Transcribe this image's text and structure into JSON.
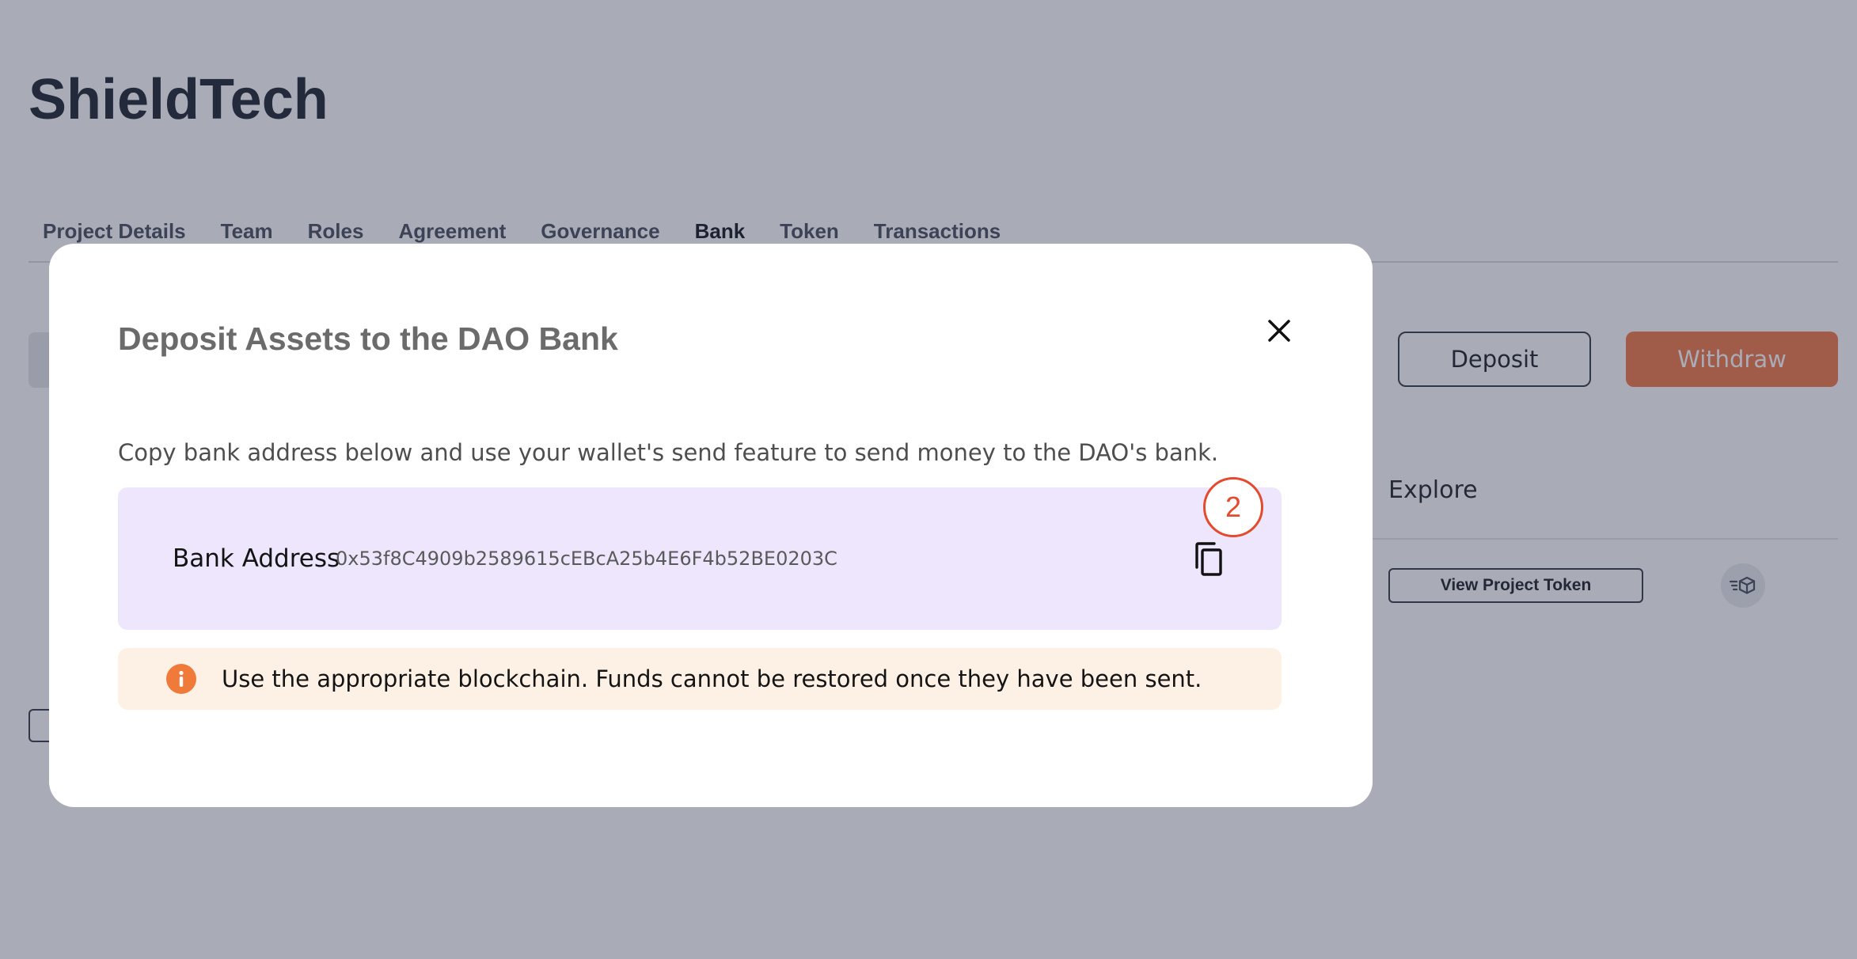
{
  "project": {
    "title": "ShieldTech"
  },
  "tabs": [
    {
      "label": "Project Details"
    },
    {
      "label": "Team"
    },
    {
      "label": "Roles"
    },
    {
      "label": "Agreement"
    },
    {
      "label": "Governance"
    },
    {
      "label": "Bank",
      "active": true
    },
    {
      "label": "Token"
    },
    {
      "label": "Transactions"
    }
  ],
  "bank_actions": {
    "deposit_label": "Deposit",
    "withdraw_label": "Withdraw"
  },
  "token_section": {
    "explore_label": "Explore",
    "view_token_label": "View Project Token"
  },
  "modal": {
    "title": "Deposit Assets to the DAO Bank",
    "description": "Copy bank address below and use your wallet's send feature to send money to the DAO's bank.",
    "address_label": "Bank Address",
    "address_value": "0x53f8C4909b2589615cEBcA25b4E6F4b52BE0203C",
    "step_badge": "2",
    "warning": "Use the appropriate blockchain. Funds cannot be restored once they have been sent."
  },
  "icons": {
    "close": "close-icon",
    "copy": "copy-icon",
    "info": "info-icon",
    "token_explorer": "token-explorer-icon"
  },
  "colors": {
    "accent": "#f07a49",
    "overlay": "#282f48",
    "address_box": "#ede6fd",
    "warning_box": "#fdf1e6",
    "warning_icon": "#f07a3a",
    "step_badge": "#e34a2e"
  }
}
